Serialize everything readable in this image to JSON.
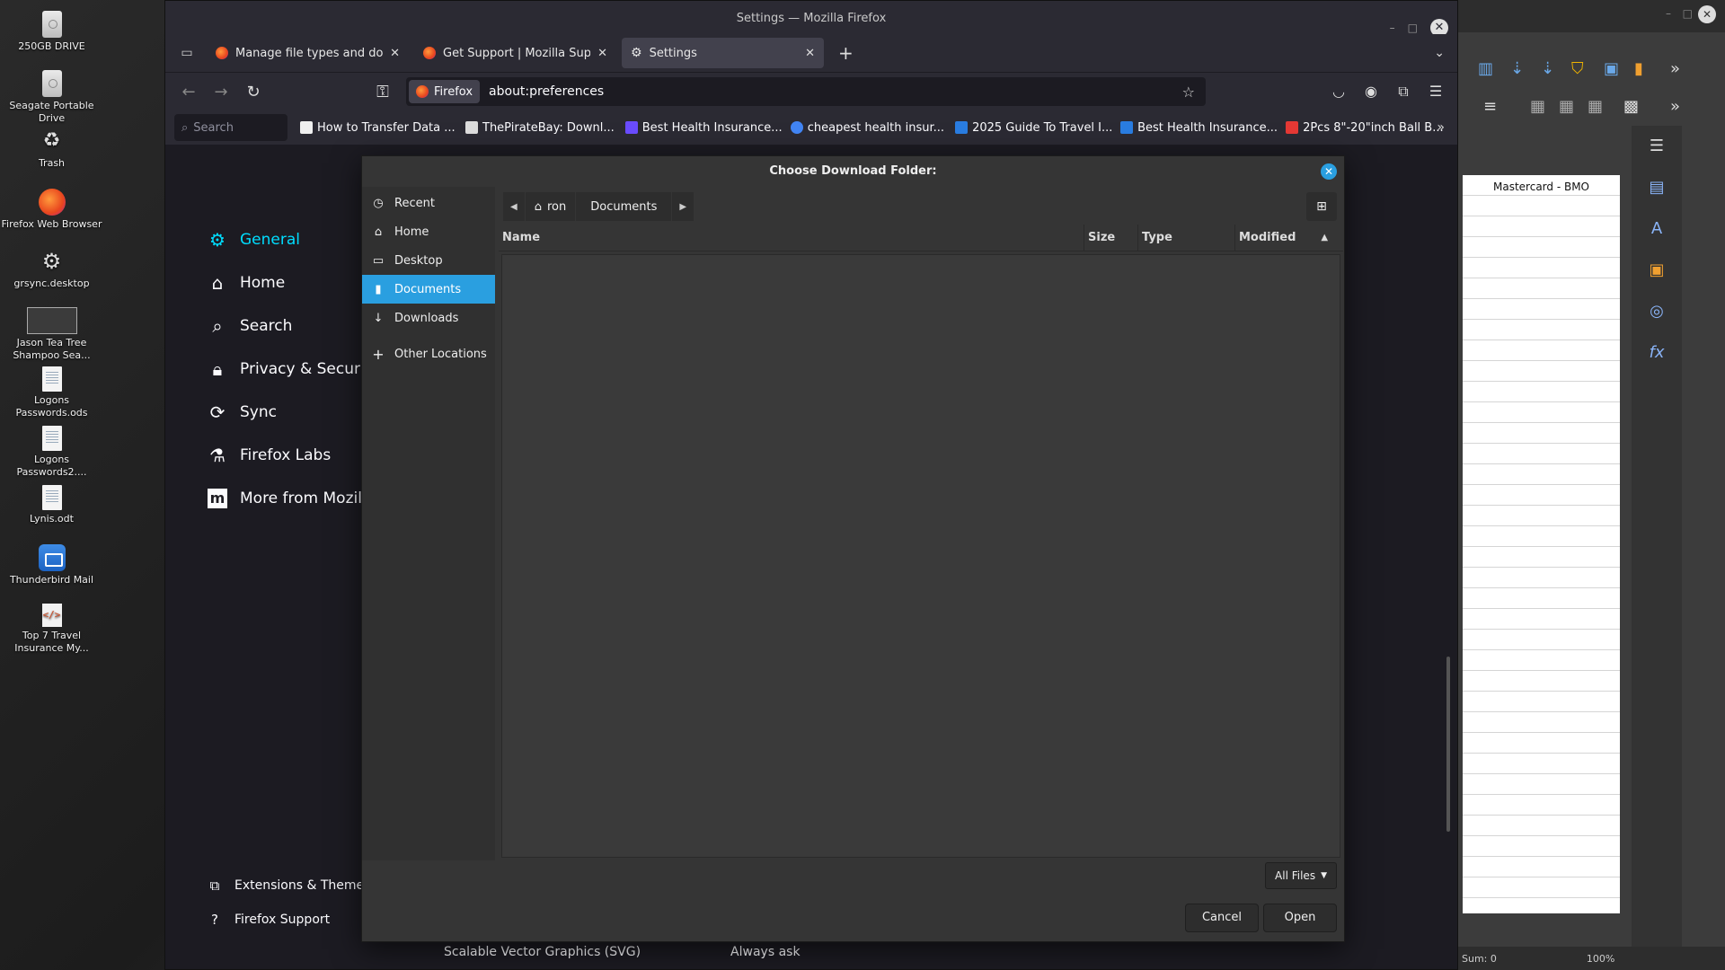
{
  "desktop": {
    "icons": [
      {
        "label": "250GB DRIVE"
      },
      {
        "label": "Seagate Portable Drive"
      },
      {
        "label": "Trash"
      },
      {
        "label": "Firefox Web Browser"
      },
      {
        "label": "grsync.desktop"
      },
      {
        "label": "Jason Tea Tree Shampoo Sea..."
      },
      {
        "label": "Logons Passwords.ods"
      },
      {
        "label": "Logons Passwords2...."
      },
      {
        "label": "Lynis.odt"
      },
      {
        "label": "Thunderbird Mail"
      },
      {
        "label": "Top 7 Travel Insurance My..."
      }
    ]
  },
  "firefox": {
    "window_title": "Settings — Mozilla Firefox",
    "tabs": [
      {
        "label": "Manage file types and down"
      },
      {
        "label": "Get Support | Mozilla Suppo"
      },
      {
        "label": "Settings"
      }
    ],
    "identity_label": "Firefox",
    "url": "about:preferences",
    "bookmarks_search_placeholder": "Search",
    "bookmarks": [
      {
        "label": "How to Transfer Data ...",
        "color": "#f0f0f0"
      },
      {
        "label": "ThePirateBay: Downl...",
        "color": "#dddddd"
      },
      {
        "label": "Best Health Insurance...",
        "color": "#6a4cff"
      },
      {
        "label": "cheapest health insur...",
        "color": "#4285f4"
      },
      {
        "label": "2025 Guide To Travel I...",
        "color": "#2a7de1"
      },
      {
        "label": "Best Health Insurance...",
        "color": "#2a7de1"
      },
      {
        "label": "2Pcs 8\"-20\"inch Ball B...",
        "color": "#e53935"
      }
    ]
  },
  "settings": {
    "nav": [
      {
        "label": "General",
        "icon": "gear-icon"
      },
      {
        "label": "Home",
        "icon": "home-icon"
      },
      {
        "label": "Search",
        "icon": "search-icon"
      },
      {
        "label": "Privacy & Security",
        "icon": "lock-icon"
      },
      {
        "label": "Sync",
        "icon": "sync-icon"
      },
      {
        "label": "Firefox Labs",
        "icon": "labs-icon"
      },
      {
        "label": "More from Mozilla",
        "icon": "mozilla-icon"
      }
    ],
    "footer": [
      {
        "label": "Extensions & Themes"
      },
      {
        "label": "Firefox Support"
      }
    ],
    "behind_row": {
      "type_label": "Scalable Vector Graphics (SVG)",
      "action_label": "Always ask"
    }
  },
  "dialog": {
    "title": "Choose Download Folder:",
    "places": [
      {
        "label": "Recent"
      },
      {
        "label": "Home"
      },
      {
        "label": "Desktop"
      },
      {
        "label": "Documents"
      },
      {
        "label": "Downloads"
      },
      {
        "label": "Other Locations"
      }
    ],
    "path": {
      "home_segment": "ron",
      "current_segment": "Documents"
    },
    "columns": {
      "name": "Name",
      "size": "Size",
      "type": "Type",
      "modified": "Modified"
    },
    "filter_label": "All Files",
    "cancel_label": "Cancel",
    "open_label": "Open"
  },
  "libreoffice": {
    "header_text": "Mastercard - BMO",
    "status_sum": "Sum: 0",
    "zoom": "100%"
  },
  "colors": {
    "accent_blue": "#2a9fe0",
    "firefox_selected": "#00ddff"
  }
}
